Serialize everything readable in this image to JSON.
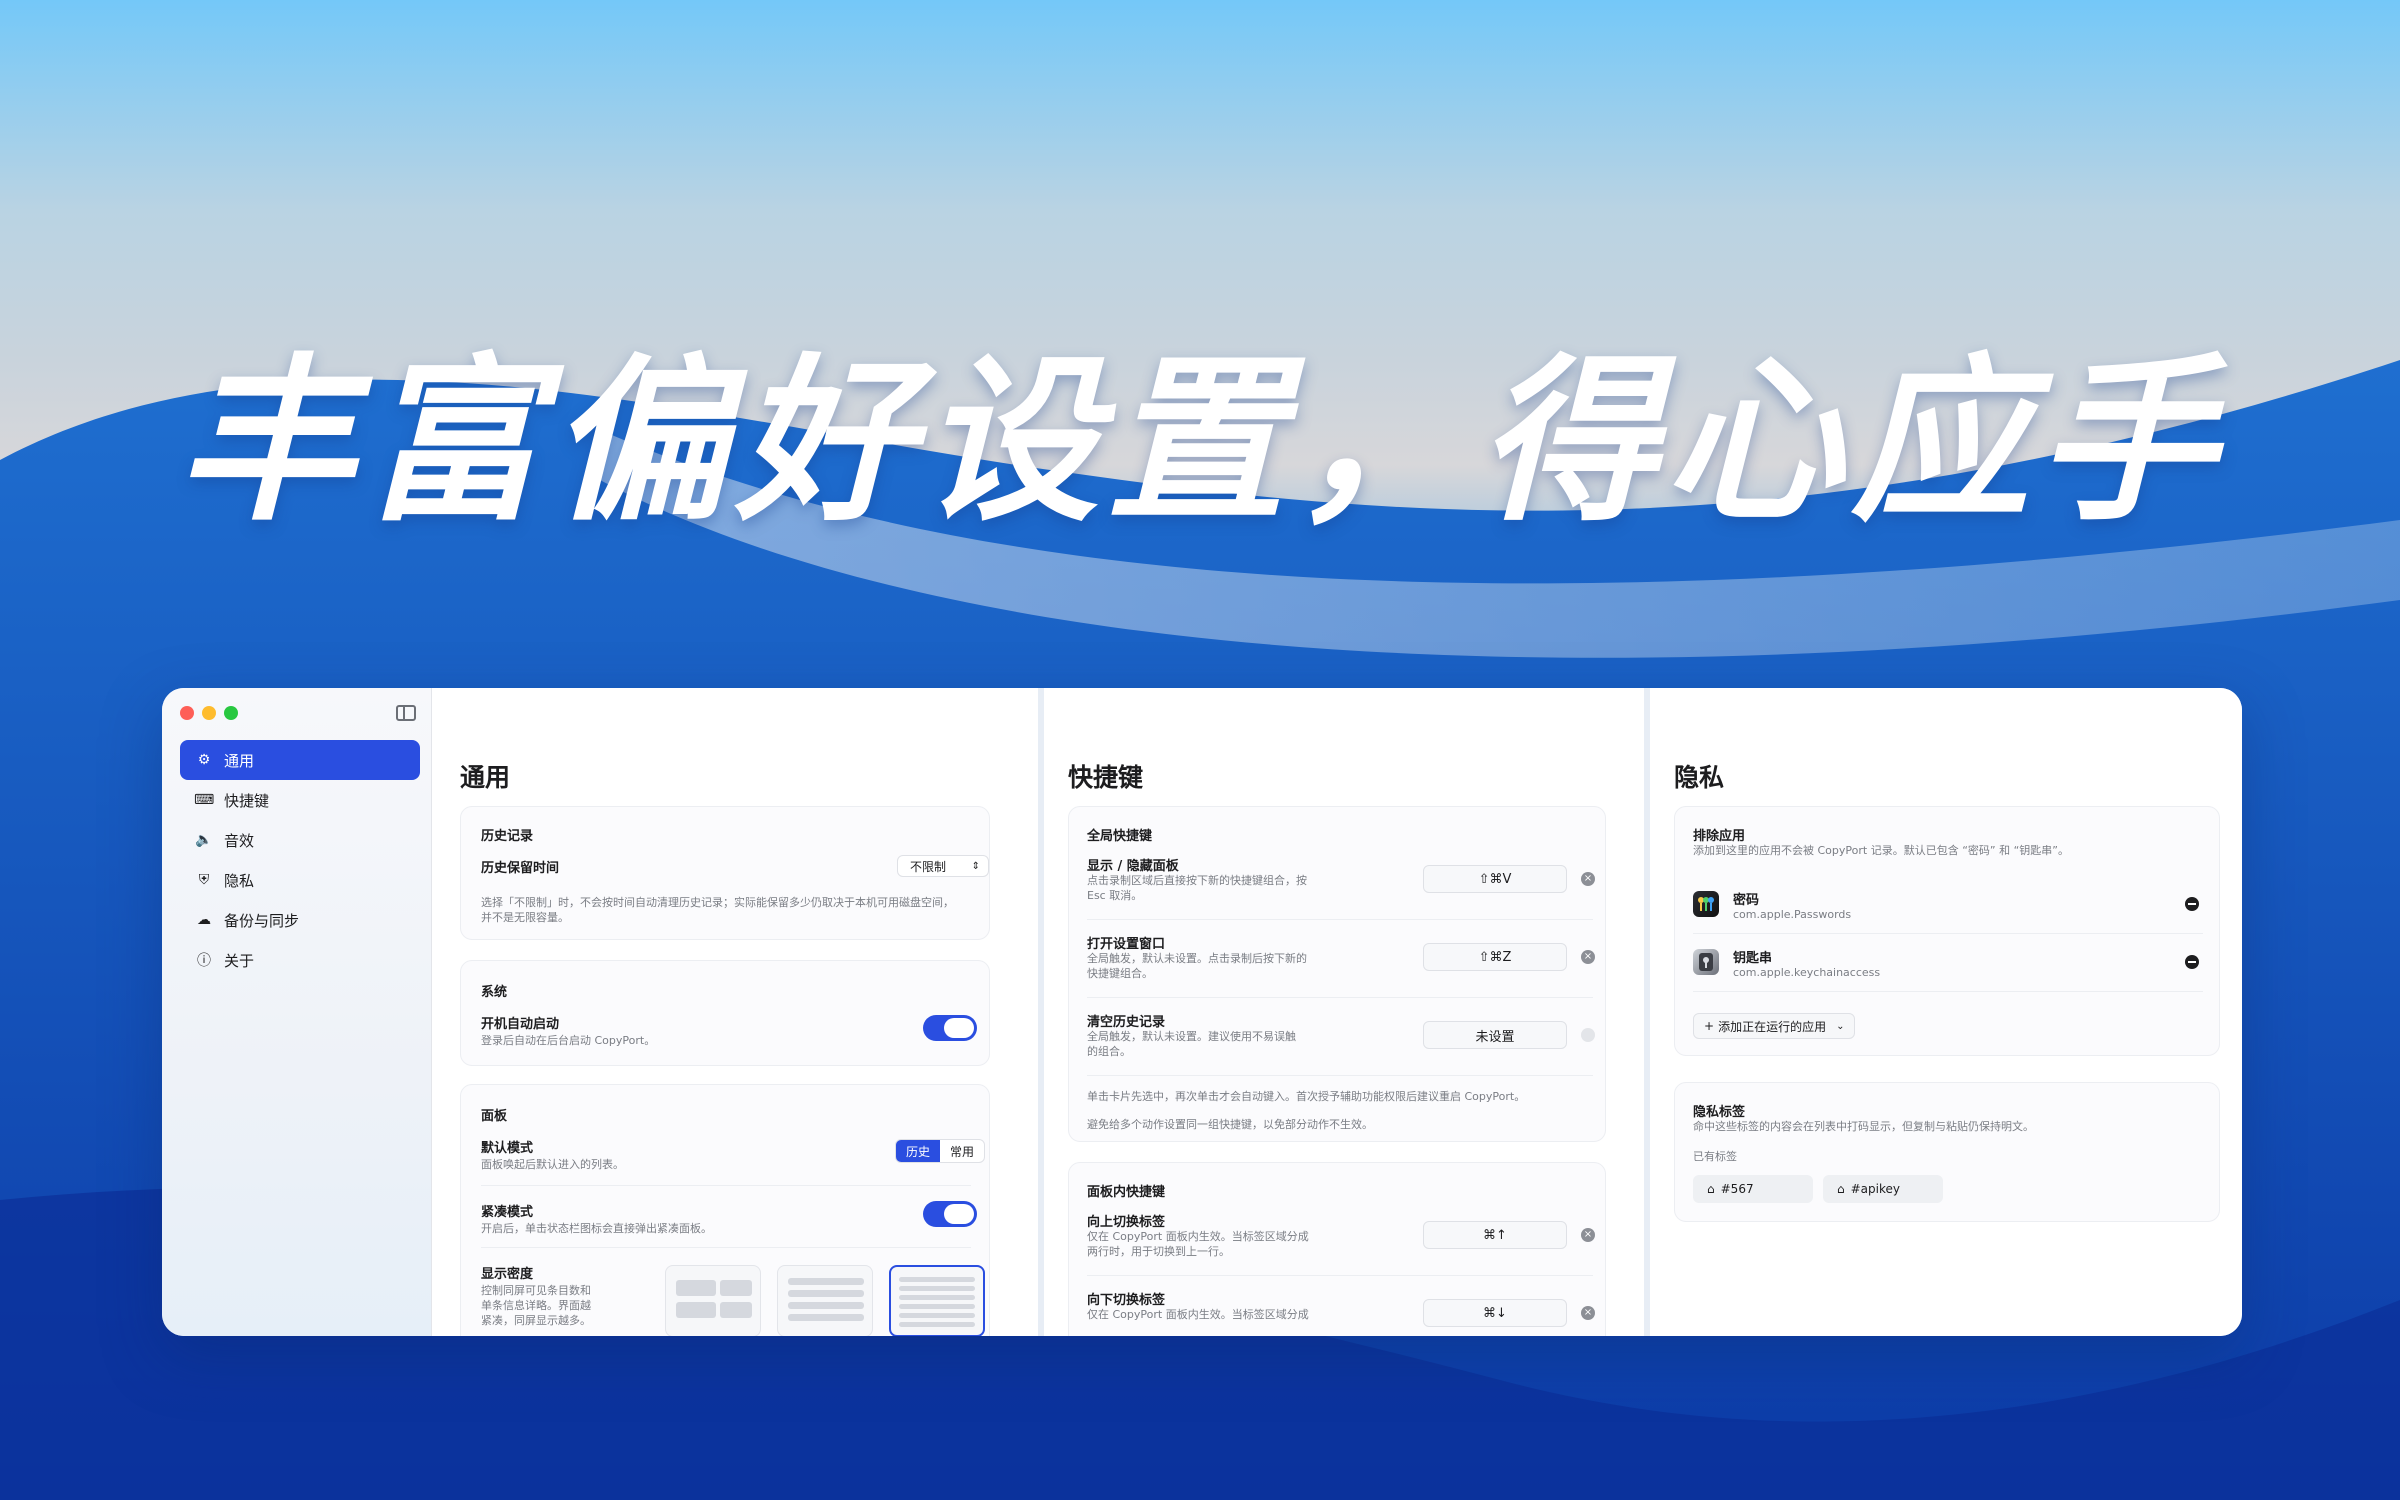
{
  "headline": "丰富偏好设置，得心应手",
  "sidebar": {
    "items": [
      {
        "label": "通用",
        "icon": "gear-icon"
      },
      {
        "label": "快捷键",
        "icon": "keyboard-icon"
      },
      {
        "label": "音效",
        "icon": "speaker-icon"
      },
      {
        "label": "隐私",
        "icon": "shield-icon"
      },
      {
        "label": "备份与同步",
        "icon": "cloud-icon"
      },
      {
        "label": "关于",
        "icon": "info-icon"
      }
    ]
  },
  "general": {
    "title": "通用",
    "history": {
      "title": "历史记录",
      "retention_label": "历史保留时间",
      "retention_value": "不限制",
      "desc1": "选择「不限制」时，不会按时间自动清理历史记录；实际能保留多少仍取决于本机可用磁盘空间，",
      "desc2": "并不是无限容量。"
    },
    "system": {
      "title": "系统",
      "launch_label": "开机自动启动",
      "launch_desc": "登录后自动在后台启动 CopyPort。"
    },
    "panel": {
      "title": "面板",
      "default_mode_label": "默认模式",
      "default_mode_desc": "面板唤起后默认进入的列表。",
      "mode_options": [
        "历史",
        "常用"
      ],
      "compact_label": "紧凑模式",
      "compact_desc": "开启后，单击状态栏图标会直接弹出紧凑面板。",
      "density_label": "显示密度",
      "density_desc1": "控制同屏可见条目数和",
      "density_desc2": "单条信息详略。界面越",
      "density_desc3": "紧凑，同屏显示越多。"
    }
  },
  "shortcuts": {
    "title": "快捷键",
    "global": {
      "title": "全局快捷键",
      "rows": [
        {
          "label": "显示 / 隐藏面板",
          "desc1": "点击录制区域后直接按下新的快捷键组合，按",
          "desc2": "Esc 取消。",
          "key": "⇧⌘V"
        },
        {
          "label": "打开设置窗口",
          "desc1": "全局触发，默认未设置。点击录制后按下新的",
          "desc2": "快捷键组合。",
          "key": "⇧⌘Z"
        },
        {
          "label": "清空历史记录",
          "desc1": "全局触发，默认未设置。建议使用不易误触",
          "desc2": "的组合。",
          "key": "未设置"
        }
      ],
      "note1": "单击卡片先选中，再次单击才会自动键入。首次授予辅助功能权限后建议重启 CopyPort。",
      "note2": "避免给多个动作设置同一组快捷键，以免部分动作不生效。"
    },
    "panel": {
      "title": "面板内快捷键",
      "rows": [
        {
          "label": "向上切换标签",
          "desc1": "仅在 CopyPort 面板内生效。当标签区域分成",
          "desc2": "两行时，用于切换到上一行。",
          "key": "⌘↑"
        },
        {
          "label": "向下切换标签",
          "desc1": "仅在 CopyPort 面板内生效。当标签区域分成",
          "desc2": "",
          "key": "⌘↓"
        }
      ]
    }
  },
  "privacy": {
    "title": "隐私",
    "excluded": {
      "title": "排除应用",
      "desc": "添加到这里的应用不会被 CopyPort 记录。默认已包含 “密码” 和 “钥匙串”。",
      "apps": [
        {
          "name": "密码",
          "bundle": "com.apple.Passwords"
        },
        {
          "name": "钥匙串",
          "bundle": "com.apple.keychainaccess"
        }
      ],
      "add_button": "添加正在运行的应用"
    },
    "tags": {
      "title": "隐私标签",
      "desc": "命中这些标签的内容会在列表中打码显示，但复制与粘贴仍保持明文。",
      "existing_label": "已有标签",
      "items": [
        "#567",
        "#apikey"
      ]
    }
  },
  "colors": {
    "accent": "#2a4ee0",
    "close": "#fe5f57",
    "minimize": "#febc2e",
    "zoom": "#28c840"
  }
}
